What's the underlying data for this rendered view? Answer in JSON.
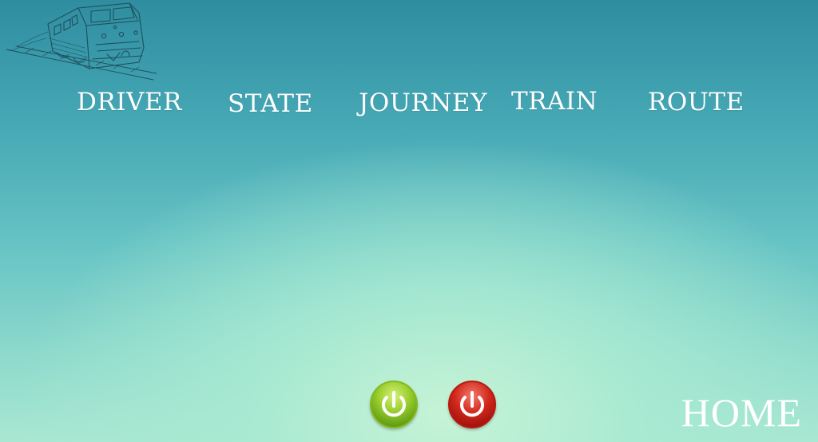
{
  "nav": {
    "items": [
      {
        "label": "DRIVER"
      },
      {
        "label": "STATE"
      },
      {
        "label": "JOURNEY"
      },
      {
        "label": "TRAIN"
      },
      {
        "label": "ROUTE"
      }
    ]
  },
  "controls": {
    "power_on_icon": "power-icon",
    "power_off_icon": "power-icon",
    "power_on_color": "#8cc63f",
    "power_off_color": "#d32f2f"
  },
  "footer": {
    "home_label": "HOME"
  },
  "logo": {
    "icon": "train-sketch-icon"
  },
  "colors": {
    "background_top": "#2f8da0",
    "background_bottom": "#a9e7d2",
    "text": "#ffffff"
  }
}
